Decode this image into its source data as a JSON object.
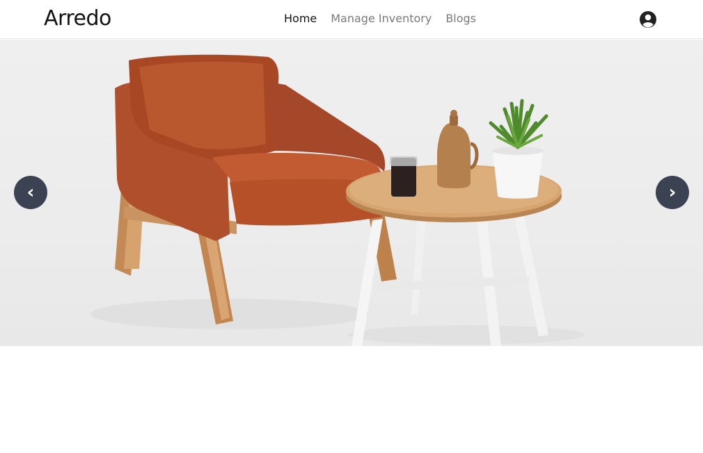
{
  "brand": {
    "name": "Arredo"
  },
  "nav": {
    "items": [
      {
        "label": "Home",
        "active": true
      },
      {
        "label": "Manage Inventory",
        "active": false
      },
      {
        "label": "Blogs",
        "active": false
      }
    ]
  },
  "header": {
    "account_icon": "user-circle-icon"
  },
  "carousel": {
    "prev_label": "‹",
    "next_label": "›",
    "prev_icon": "chevron-left-icon",
    "next_icon": "chevron-right-icon"
  },
  "colors": {
    "nav_active": "#111111",
    "nav_inactive": "#7a7a7a",
    "carousel_button": "#3b4252",
    "leather": "#b5532d",
    "wood": "#c99462"
  }
}
